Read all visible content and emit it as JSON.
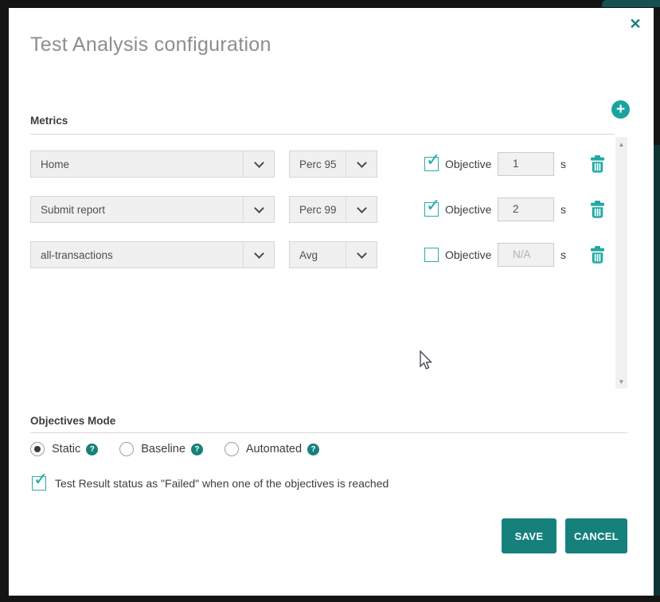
{
  "dialog": {
    "title": "Test Analysis configuration"
  },
  "metrics": {
    "heading": "Metrics",
    "rows": [
      {
        "metric": "Home",
        "aggregation": "Perc 95",
        "objective_label": "Objective",
        "objective_checked": true,
        "value": "1",
        "unit": "s"
      },
      {
        "metric": "Submit report",
        "aggregation": "Perc 99",
        "objective_label": "Objective",
        "objective_checked": true,
        "value": "2",
        "unit": "s"
      },
      {
        "metric": "all-transactions",
        "aggregation": "Avg",
        "objective_label": "Objective",
        "objective_checked": false,
        "value": "N/A",
        "unit": "s"
      }
    ]
  },
  "objectives_mode": {
    "heading": "Objectives Mode",
    "options": [
      {
        "label": "Static",
        "selected": true
      },
      {
        "label": "Baseline",
        "selected": false
      },
      {
        "label": "Automated",
        "selected": false
      }
    ],
    "fail_checkbox": {
      "label": "Test Result status as \"Failed\" when one of the objectives is reached",
      "checked": true
    }
  },
  "actions": {
    "save": "SAVE",
    "cancel": "CANCEL"
  },
  "icons": {
    "close": "✕",
    "add": "+",
    "help": "?",
    "check": "✓",
    "scroll_up": "▲",
    "scroll_down": "▼"
  },
  "colors": {
    "accent": "#16817c",
    "icon_teal": "#21a9a3",
    "panel": "#ffffff",
    "backdrop": "#141414"
  }
}
